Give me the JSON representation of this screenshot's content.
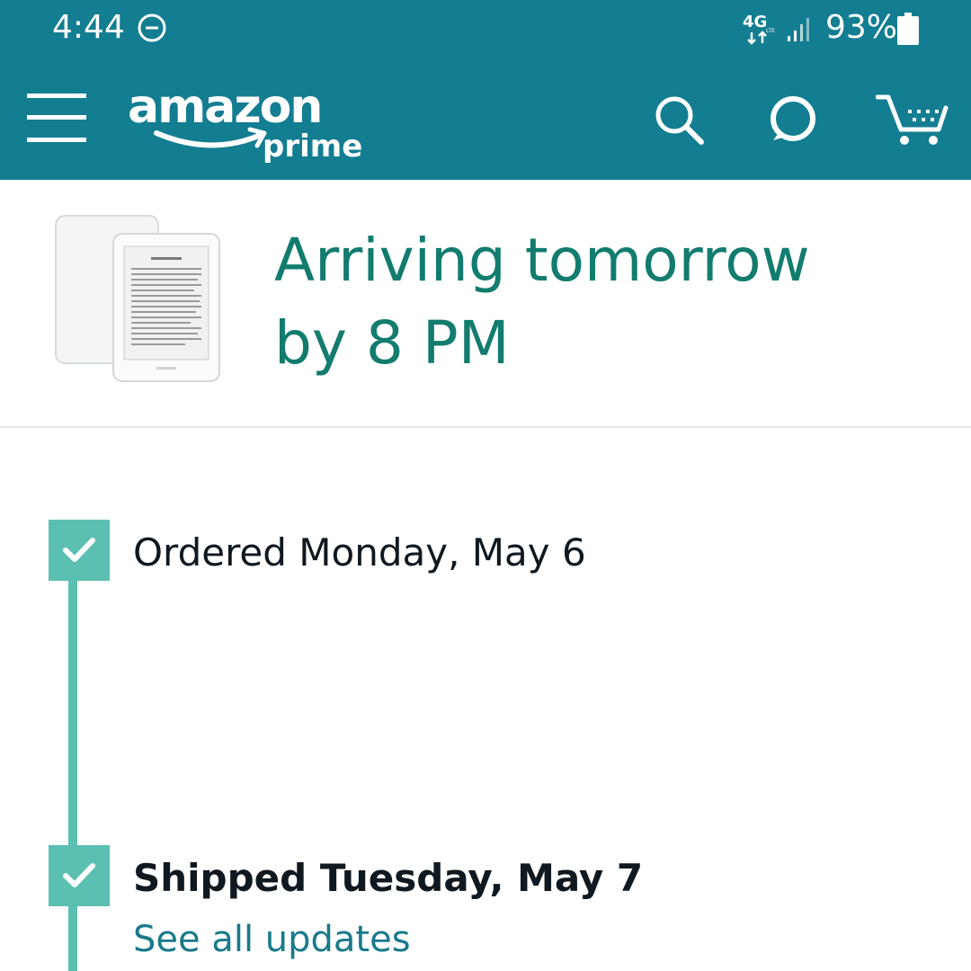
{
  "status_bar": {
    "time": "4:44",
    "dnd_icon": "do-not-disturb-icon",
    "network_label": "4G",
    "network_sub": "LTE",
    "signal_icon": "signal-bars-icon",
    "battery_percent": "93%",
    "battery_icon": "battery-icon"
  },
  "header": {
    "menu_icon": "hamburger-menu-icon",
    "logo_wordmark": "amazon",
    "logo_sub": "prime",
    "search_icon": "search-icon",
    "alexa_icon": "alexa-icon",
    "cart_icon": "cart-icon"
  },
  "delivery": {
    "status_line1": "Arriving tomorrow",
    "status_line2": "by 8 PM"
  },
  "tracking": {
    "steps": [
      {
        "label": "Ordered Monday, May 6",
        "completed": true
      },
      {
        "label": "Shipped Tuesday, May 7",
        "completed": true
      }
    ],
    "see_all_updates": "See all updates"
  },
  "colors": {
    "header_bg": "#137d91",
    "accent_text": "#127c6e",
    "track": "#5bbfb2",
    "link": "#1a7a8a"
  }
}
